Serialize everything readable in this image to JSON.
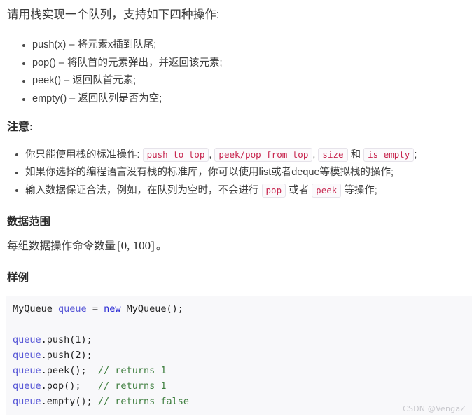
{
  "intro": "请用栈实现一个队列，支持如下四种操作:",
  "operations": [
    "push(x) – 将元素x插到队尾;",
    "pop() – 将队首的元素弹出，并返回该元素;",
    "peek() – 返回队首元素;",
    "empty() – 返回队列是否为空;"
  ],
  "notes": {
    "heading": "注意:",
    "item1": {
      "prefix": "你只能使用栈的标准操作:",
      "code1": "push to top",
      "sep1": ",",
      "code2": "peek/pop from top",
      "sep2": ",",
      "code3": "size",
      "conj": "和",
      "code4": "is empty",
      "suffix": ";"
    },
    "item2": "如果你选择的编程语言没有栈的标准库，你可以使用list或者deque等模拟栈的操作;",
    "item3": {
      "prefix": "输入数据保证合法，例如，在队列为空时，不会进行",
      "code1": "pop",
      "middle": "或者",
      "code2": "peek",
      "suffix": "等操作;"
    }
  },
  "range": {
    "heading": "数据范围",
    "text_before": "每组数据操作命令数量",
    "math": "[0, 100]",
    "text_after": "。"
  },
  "sample": {
    "heading": "样例",
    "code_lines": [
      {
        "tokens": [
          {
            "text": "MyQueue",
            "type": "type"
          },
          {
            "text": " ",
            "type": "punct"
          },
          {
            "text": "queue",
            "type": "var"
          },
          {
            "text": " = ",
            "type": "punct"
          },
          {
            "text": "new",
            "type": "kw"
          },
          {
            "text": " MyQueue();",
            "type": "type"
          }
        ]
      },
      {
        "tokens": []
      },
      {
        "tokens": [
          {
            "text": "queue",
            "type": "var"
          },
          {
            "text": ".push(1);",
            "type": "punct"
          }
        ]
      },
      {
        "tokens": [
          {
            "text": "queue",
            "type": "var"
          },
          {
            "text": ".push(2);",
            "type": "punct"
          }
        ]
      },
      {
        "tokens": [
          {
            "text": "queue",
            "type": "var"
          },
          {
            "text": ".peek();  ",
            "type": "punct"
          },
          {
            "text": "// returns 1",
            "type": "comment"
          }
        ]
      },
      {
        "tokens": [
          {
            "text": "queue",
            "type": "var"
          },
          {
            "text": ".pop();   ",
            "type": "punct"
          },
          {
            "text": "// returns 1",
            "type": "comment"
          }
        ]
      },
      {
        "tokens": [
          {
            "text": "queue",
            "type": "var"
          },
          {
            "text": ".empty(); ",
            "type": "punct"
          },
          {
            "text": "// returns false",
            "type": "comment"
          }
        ]
      }
    ]
  },
  "watermark": "CSDN @VengaZ",
  "colors": {
    "inline_code_text": "#c7254e",
    "code_variable": "#5656d6",
    "code_keyword": "#2b2bd4",
    "code_comment": "#3f7f3f",
    "code_bg": "#f8f8fa",
    "watermark": "#c9c9ce"
  }
}
